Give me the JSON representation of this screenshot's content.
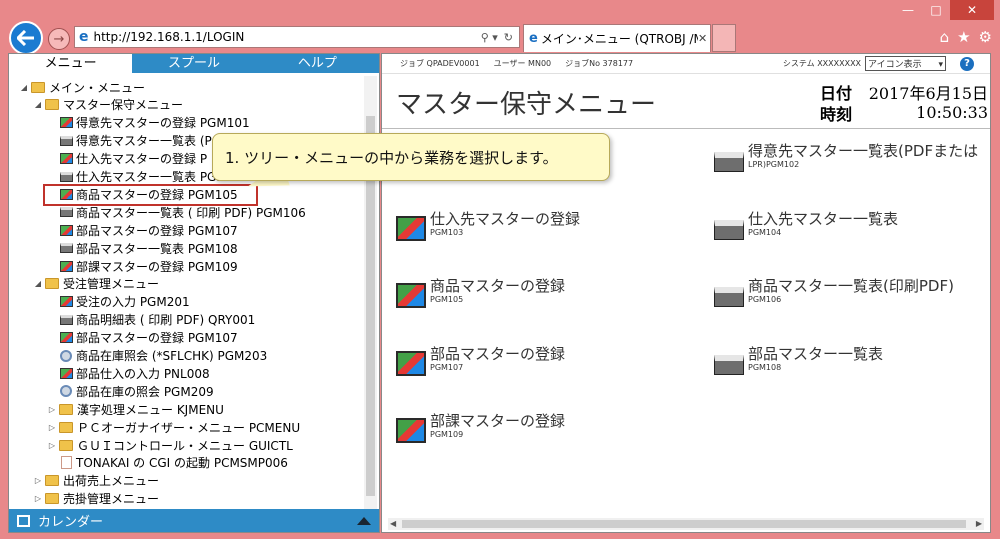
{
  "browser": {
    "url": "http://192.168.1.1/LOGIN",
    "tab_title": "メイン･メニュー (QTROBJ /M...",
    "icons": [
      "back-icon",
      "forward-icon",
      "ie-icon",
      "search-icon",
      "refresh-icon",
      "home-icon",
      "star-icon",
      "gear-icon"
    ]
  },
  "left_panel": {
    "tabs": [
      "メニュー",
      "スプール",
      "ヘルプ"
    ],
    "tree": [
      {
        "label": "メイン・メニュー",
        "icon": "folder"
      },
      {
        "label": "マスター保守メニュー",
        "icon": "folder"
      },
      {
        "label": "得意先マスターの登録 PGM101",
        "icon": "monitor"
      },
      {
        "label": "得意先マスター一覧表 (P",
        "icon": "printer"
      },
      {
        "label": "仕入先マスターの登録 P",
        "icon": "monitor"
      },
      {
        "label": "仕入先マスター一覧表 PGM104",
        "icon": "printer"
      },
      {
        "label": "商品マスターの登録 PGM105",
        "icon": "monitor"
      },
      {
        "label": "商品マスター一覧表 ( 印刷 PDF) PGM106",
        "icon": "printer"
      },
      {
        "label": "部品マスターの登録 PGM107",
        "icon": "monitor"
      },
      {
        "label": "部品マスター一覧表 PGM108",
        "icon": "printer"
      },
      {
        "label": "部課マスターの登録 PGM109",
        "icon": "monitor"
      },
      {
        "label": "受注管理メニュー",
        "icon": "folder"
      },
      {
        "label": "受注の入力 PGM201",
        "icon": "monitor"
      },
      {
        "label": "商品明細表 ( 印刷 PDF) QRY001",
        "icon": "printer"
      },
      {
        "label": "部品マスターの登録 PGM107",
        "icon": "monitor"
      },
      {
        "label": "商品在庫照会 (*SFLCHK) PGM203",
        "icon": "gear"
      },
      {
        "label": "部品仕入の入力 PNL008",
        "icon": "monitor"
      },
      {
        "label": "部品在庫の照会 PGM209",
        "icon": "gear"
      },
      {
        "label": "漢字処理メニュー KJMENU",
        "icon": "folder"
      },
      {
        "label": "ＰＣオーガナイザー・メニュー PCMENU",
        "icon": "folder"
      },
      {
        "label": "ＧＵＩコントロール・メニュー GUICTL",
        "icon": "folder"
      },
      {
        "label": "TONAKAI の CGI の起動 PCMSMP006",
        "icon": "doc"
      },
      {
        "label": "出荷売上メニュー",
        "icon": "folder"
      },
      {
        "label": "売掛管理メニュー",
        "icon": "folder"
      }
    ],
    "calendar_label": "カレンダー"
  },
  "right_panel": {
    "info": {
      "job": "ジョブ  QPADEV0001",
      "user": "ユーザー  MN00",
      "jobno": "ジョブNo  378177",
      "system": "システム  XXXXXXXX",
      "icon_display": "アイコン表示"
    },
    "page_title": "マスター保守メニュー",
    "date_label": "日付",
    "date_value": "2017年6月15日",
    "time_label": "時刻",
    "time_value": "10:50:33",
    "items": [
      {
        "title": "得意先マスター一覧表(PDFまたは",
        "code": "LPR)PGM102",
        "icon": "printer"
      },
      {
        "title": "仕入先マスターの登録",
        "code": "PGM103",
        "icon": "monitor"
      },
      {
        "title": "仕入先マスター一覧表",
        "code": "PGM104",
        "icon": "printer"
      },
      {
        "title": "商品マスターの登録",
        "code": "PGM105",
        "icon": "monitor"
      },
      {
        "title": "商品マスター一覧表(印刷PDF)",
        "code": "PGM106",
        "icon": "printer"
      },
      {
        "title": "部品マスターの登録",
        "code": "PGM107",
        "icon": "monitor"
      },
      {
        "title": "部品マスター一覧表",
        "code": "PGM108",
        "icon": "printer"
      },
      {
        "title": "部課マスターの登録",
        "code": "PGM109",
        "icon": "monitor"
      }
    ]
  },
  "callout": {
    "text": "1. ツリー・メニューの中から業務を選択します。"
  }
}
